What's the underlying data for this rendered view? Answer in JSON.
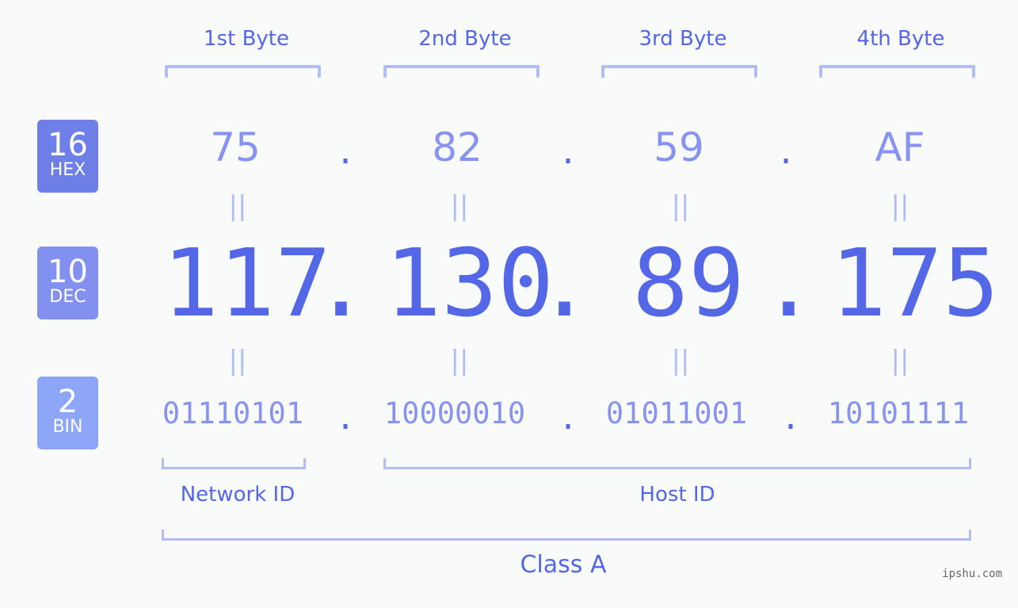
{
  "bytes": [
    {
      "label": "1st Byte",
      "hex": "75",
      "dec": "117",
      "bin": "01110101"
    },
    {
      "label": "2nd Byte",
      "hex": "82",
      "dec": "130",
      "bin": "10000010"
    },
    {
      "label": "3rd Byte",
      "hex": "59",
      "dec": "89",
      "bin": "01011001"
    },
    {
      "label": "4th Byte",
      "hex": "AF",
      "dec": "175",
      "bin": "10101111"
    }
  ],
  "badges": {
    "hex": {
      "num": "16",
      "label": "HEX",
      "color": "#6f7fe8"
    },
    "dec": {
      "num": "10",
      "label": "DEC",
      "color": "#8291ef"
    },
    "bin": {
      "num": "2",
      "label": "BIN",
      "color": "#8ea6f7"
    }
  },
  "separator": ".",
  "equals": "||",
  "network_label": "Network ID",
  "host_label": "Host ID",
  "class_label": "Class A",
  "watermark": "ipshu.com",
  "colors": {
    "accent": "#5467e6",
    "light": "#8793ee",
    "bracket": "#b3bdf5"
  }
}
